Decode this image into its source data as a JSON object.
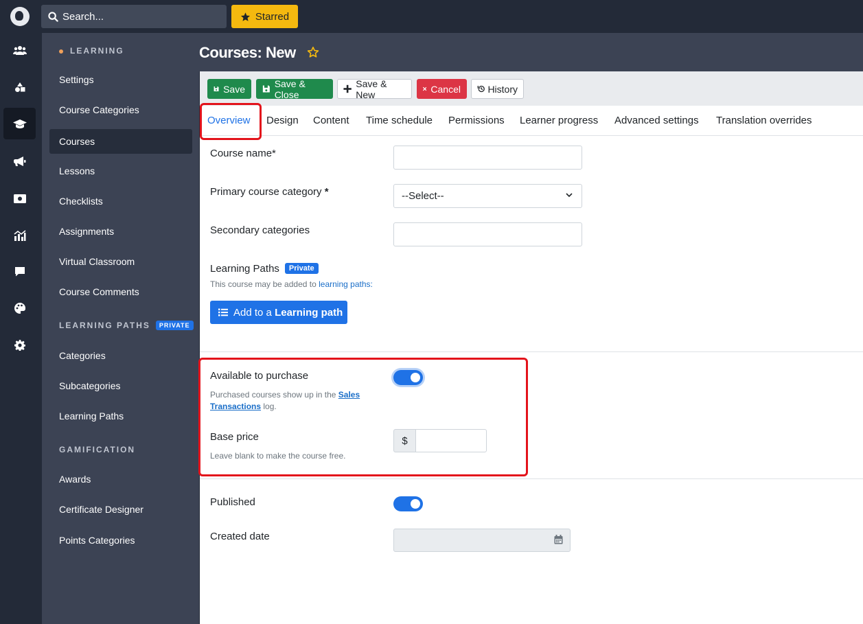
{
  "topbar": {
    "search_placeholder": "Search...",
    "starred_label": "Starred"
  },
  "rail": [
    "users-icon",
    "shapes-icon",
    "graduation-cap-icon",
    "megaphone-icon",
    "money-icon",
    "chart-icon",
    "comment-icon",
    "palette-icon",
    "gear-icon"
  ],
  "sidebar": {
    "section_learning": "LEARNING",
    "items_learning": [
      "Settings",
      "Course Categories",
      "Courses",
      "Lessons",
      "Checklists",
      "Assignments",
      "Virtual Classroom",
      "Course Comments"
    ],
    "section_paths": "LEARNING PATHS",
    "section_paths_badge": "PRIVATE",
    "items_paths": [
      "Categories",
      "Subcategories",
      "Learning Paths"
    ],
    "section_gamification": "GAMIFICATION",
    "items_gamification": [
      "Awards",
      "Certificate Designer",
      "Points Categories"
    ]
  },
  "header": {
    "title": "Courses: New"
  },
  "toolbar": {
    "save": "Save",
    "save_close": "Save & Close",
    "save_new": "Save & New",
    "cancel": "Cancel",
    "history": "History"
  },
  "tabs": [
    "Overview",
    "Design",
    "Content",
    "Time schedule",
    "Permissions",
    "Learner progress",
    "Advanced settings",
    "Translation overrides"
  ],
  "form": {
    "course_name_label": "Course name*",
    "course_name_value": "",
    "primary_category_label": "Primary course category",
    "primary_category_required": "*",
    "primary_category_value": "--Select--",
    "secondary_categories_label": "Secondary categories",
    "learning_paths_label": "Learning Paths",
    "learning_paths_badge": "Private",
    "learning_paths_help": "This course may be added to",
    "learning_paths_help_link": "learning paths:",
    "add_path_prefix": "Add to a",
    "add_path_bold": "Learning path",
    "available_label": "Available to purchase",
    "available_on": true,
    "available_help_pre": "Purchased courses show up in the",
    "available_help_link1": "Sales",
    "available_help_link2": "Transactions",
    "available_help_post": "log.",
    "base_price_label": "Base price",
    "base_price_currency": "$",
    "base_price_value": "",
    "base_price_help": "Leave blank to make the course free.",
    "published_label": "Published",
    "published_on": true,
    "created_date_label": "Created date",
    "created_date_value": ""
  },
  "colors": {
    "accent": "#1f72e6",
    "save": "#1f8a4c",
    "cancel": "#dc3545",
    "starred": "#f5b90f",
    "highlight": "#e3131b"
  }
}
